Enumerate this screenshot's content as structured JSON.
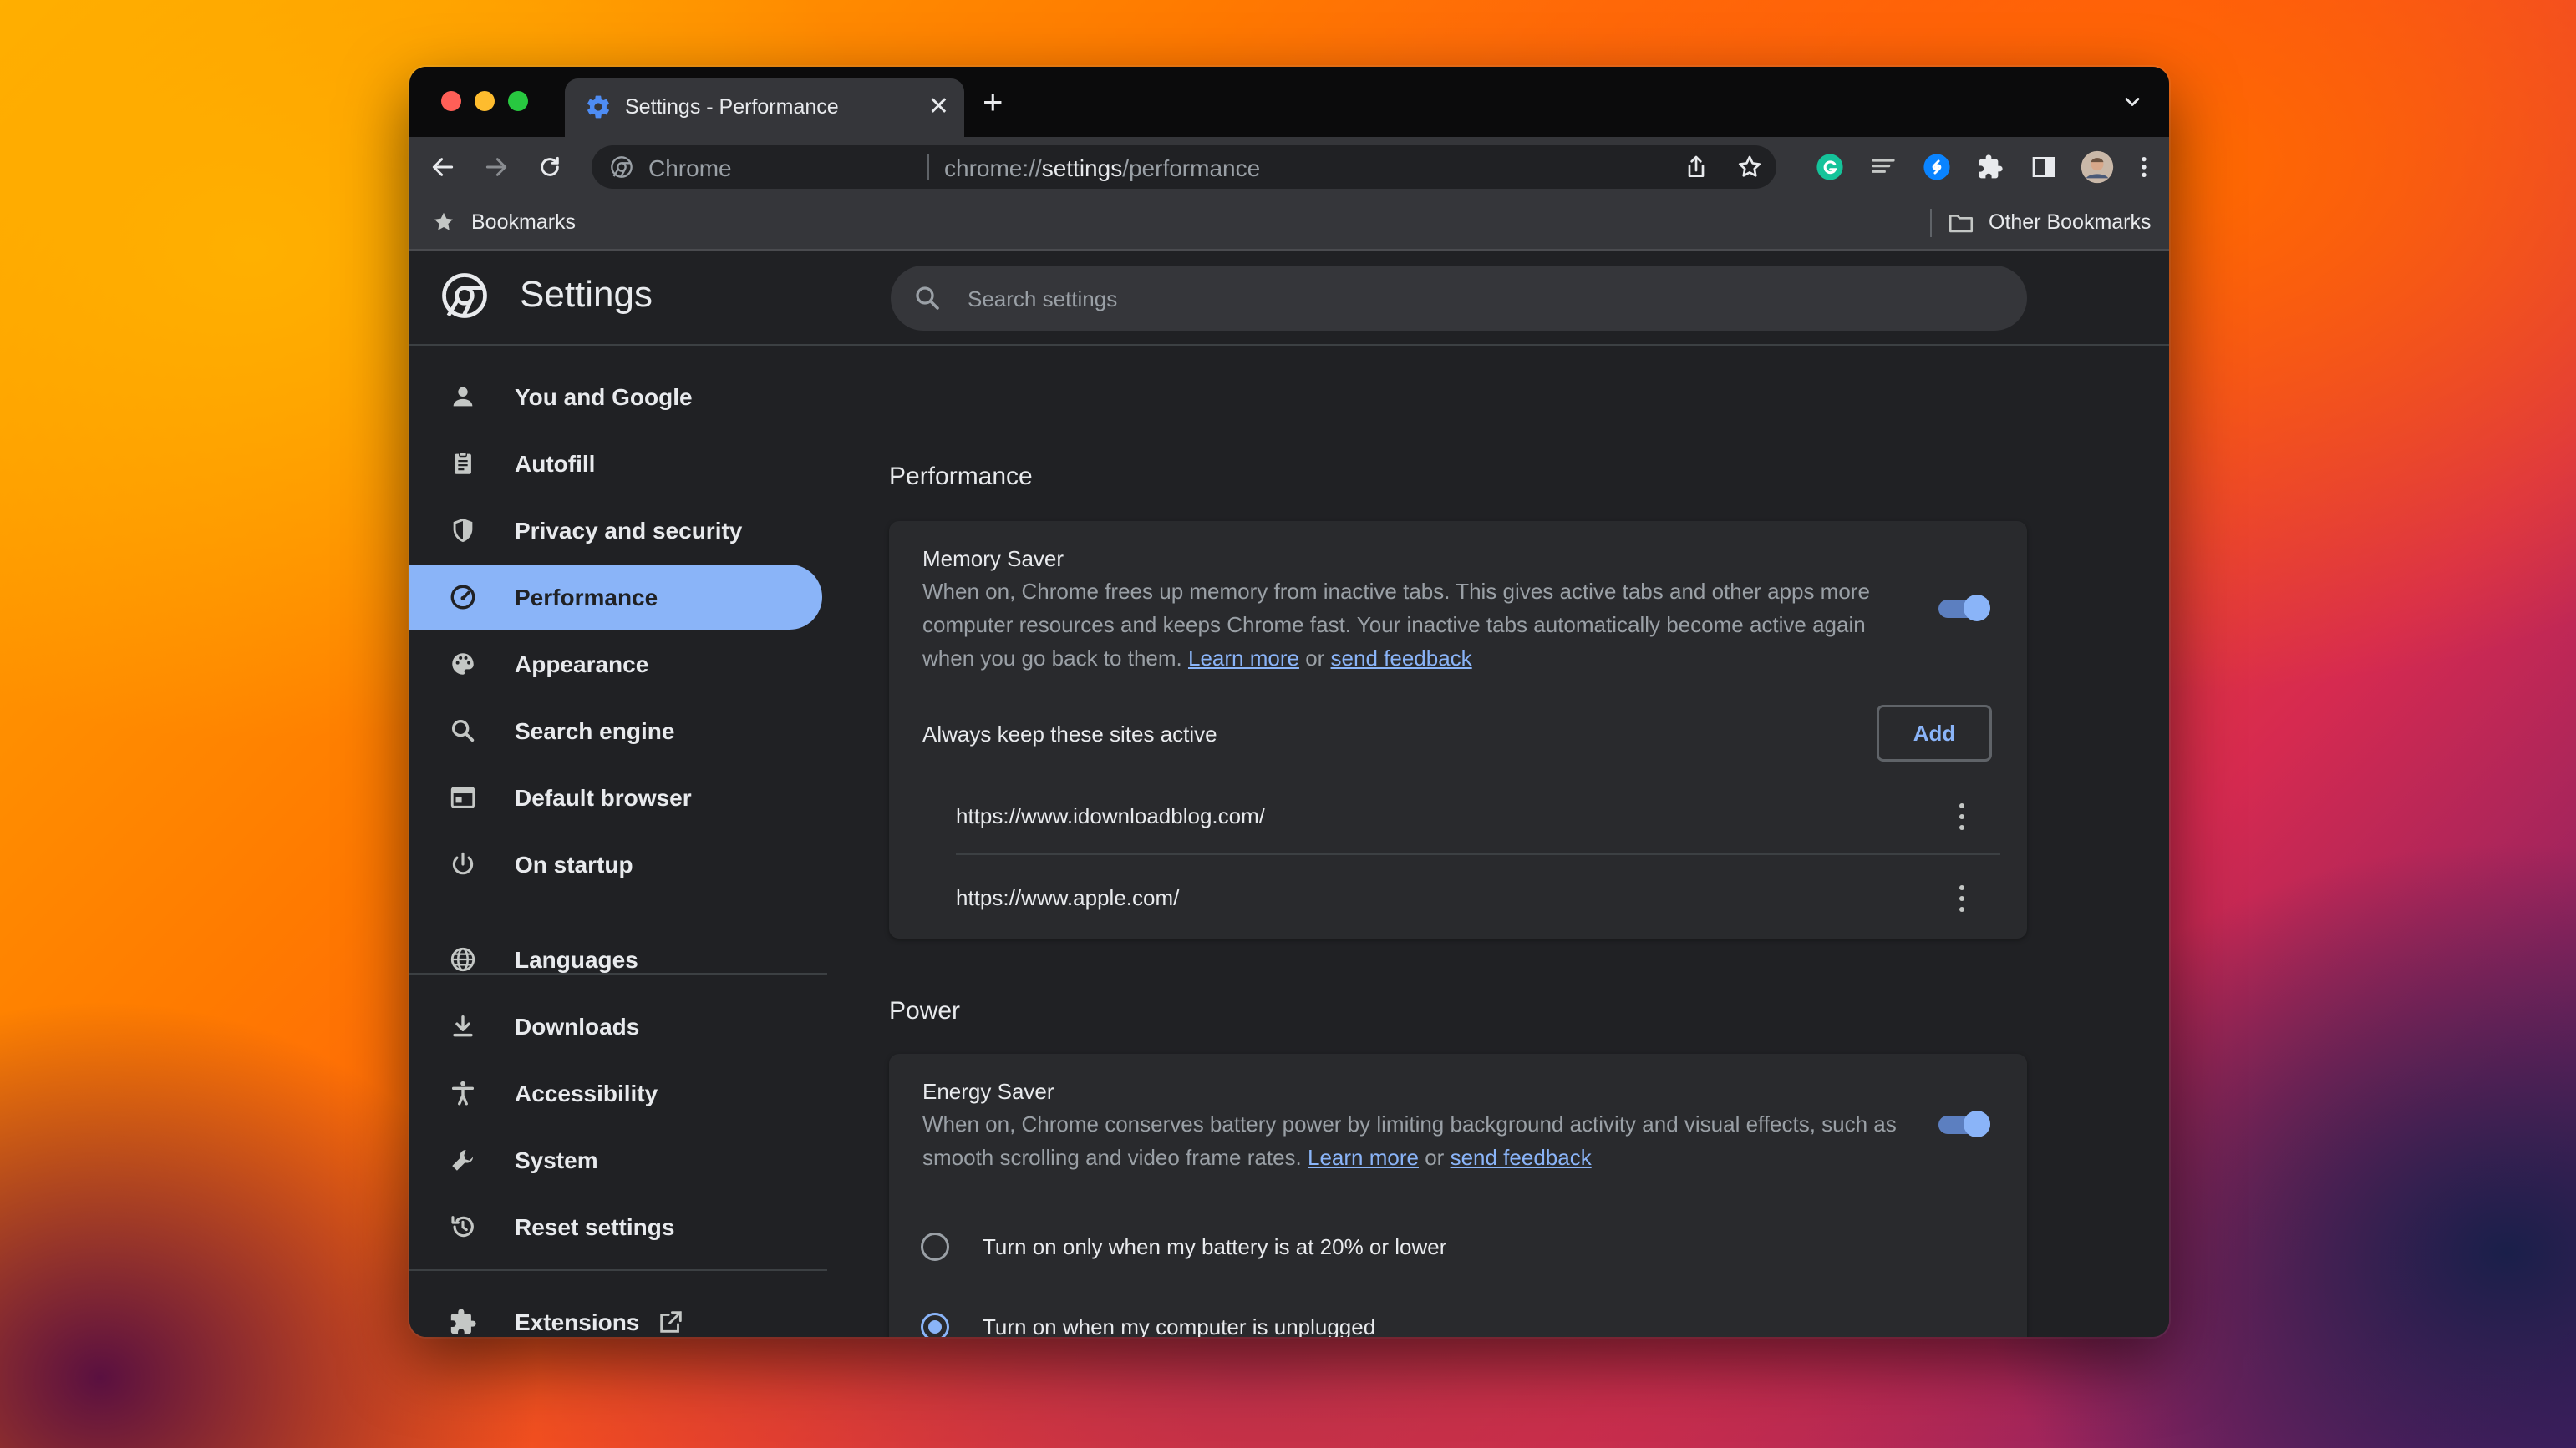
{
  "window": {
    "tab_title": "Settings - Performance",
    "tab_close": "✕",
    "new_tab": "+"
  },
  "omnibox": {
    "site_label": "Chrome",
    "url_prefix": "chrome://",
    "url_host": "settings",
    "url_path": "/performance"
  },
  "bookmarks": {
    "left_label": "Bookmarks",
    "right_label": "Other Bookmarks"
  },
  "settings": {
    "title": "Settings",
    "search_placeholder": "Search settings"
  },
  "sidebar": {
    "items": [
      {
        "label": "You and Google",
        "icon": "person-icon"
      },
      {
        "label": "Autofill",
        "icon": "clipboard-icon"
      },
      {
        "label": "Privacy and security",
        "icon": "shield-icon"
      },
      {
        "label": "Performance",
        "icon": "speedometer-icon",
        "active": true
      },
      {
        "label": "Appearance",
        "icon": "palette-icon"
      },
      {
        "label": "Search engine",
        "icon": "search-icon"
      },
      {
        "label": "Default browser",
        "icon": "browser-icon"
      },
      {
        "label": "On startup",
        "icon": "power-icon"
      },
      {
        "label": "Languages",
        "icon": "globe-icon"
      },
      {
        "label": "Downloads",
        "icon": "download-icon"
      },
      {
        "label": "Accessibility",
        "icon": "accessibility-icon"
      },
      {
        "label": "System",
        "icon": "wrench-icon"
      },
      {
        "label": "Reset settings",
        "icon": "history-icon"
      },
      {
        "label": "Extensions",
        "icon": "puzzle-icon"
      }
    ]
  },
  "performance": {
    "section_title": "Performance",
    "memory_saver": {
      "title": "Memory Saver",
      "description": "When on, Chrome frees up memory from inactive tabs. This gives active tabs and other apps more computer resources and keeps Chrome fast. Your inactive tabs automatically become active again when you go back to them.",
      "learn_more": "Learn more",
      "or": "or",
      "send_feedback": "send feedback",
      "enabled": true
    },
    "always_active": {
      "label": "Always keep these sites active",
      "add_label": "Add",
      "sites": [
        "https://www.idownloadblog.com/",
        "https://www.apple.com/"
      ]
    }
  },
  "power": {
    "section_title": "Power",
    "energy_saver": {
      "title": "Energy Saver",
      "description": "When on, Chrome conserves battery power by limiting background activity and visual effects, such as smooth scrolling and video frame rates.",
      "learn_more": "Learn more",
      "or": "or",
      "send_feedback": "send feedback",
      "enabled": true
    },
    "options": [
      {
        "label": "Turn on only when my battery is at 20% or lower",
        "selected": false
      },
      {
        "label": "Turn on when my computer is unplugged",
        "selected": true
      }
    ]
  },
  "colors": {
    "accent": "#8ab4f8",
    "background": "#202124",
    "card": "#292a2d"
  }
}
